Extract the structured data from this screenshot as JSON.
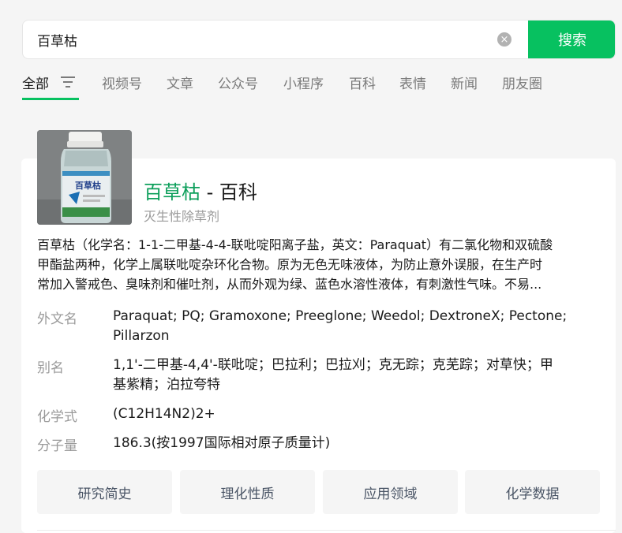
{
  "search": {
    "query": "百草枯",
    "clear_symbol": "×",
    "button_label": "搜索"
  },
  "tabs": [
    {
      "label": "全部"
    },
    {
      "label": "视频号"
    },
    {
      "label": "文章"
    },
    {
      "label": "公众号"
    },
    {
      "label": "小程序"
    },
    {
      "label": "百科"
    },
    {
      "label": "表情"
    },
    {
      "label": "新闻"
    },
    {
      "label": "朋友圈"
    }
  ],
  "result": {
    "title_highlight": "百草枯",
    "title_suffix": " - 百科",
    "subtitle": "灭生性除草剂",
    "image": {
      "label_text": "百草枯"
    },
    "description_lines": [
      "百草枯（化学名：1-1-二甲基-4-4-联吡啶阳离子盐，英文：Paraquat）有二氯化物和双硫酸",
      "甲酯盐两种，化学上属联吡啶杂环化合物。原为无色无味液体，为防止意外误服，在生产时",
      "常加入警戒色、臭味剂和催吐剂，从而外观为绿、蓝色水溶性液体，有刺激性气味。不易..."
    ],
    "info": [
      {
        "label": "外文名",
        "lines": [
          "Paraquat; PQ; Gramoxone; Preeglone; Weedol; DextroneX; Pectone;",
          "Pillarzon"
        ]
      },
      {
        "label": "别名",
        "lines": [
          "1,1'-二甲基-4,4'-联吡啶；巴拉利；巴拉刈；克无踪；克芜踪；对草快；甲",
          "基紫精；泊拉夸特"
        ]
      },
      {
        "label": "化学式",
        "lines": [
          "(C12H14N2)2+"
        ]
      },
      {
        "label": "分子量",
        "lines": [
          "186.3(按1997国际相对原子质量计)"
        ]
      }
    ],
    "buttons": [
      "研究简史",
      "理化性质",
      "应用领域",
      "化学数据"
    ]
  },
  "colors": {
    "accent": "#07c160",
    "highlight_text": "#0d9f5b",
    "muted_text": "#9a9a9a",
    "page_bg": "#f5f5f5"
  }
}
